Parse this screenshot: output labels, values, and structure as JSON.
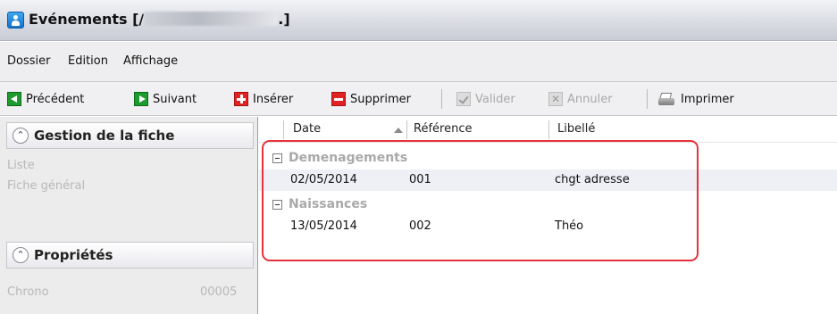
{
  "window": {
    "title": "Evénements [/",
    "title_suffix": ".]"
  },
  "menu": {
    "items": [
      "Dossier",
      "Edition",
      "Affichage"
    ]
  },
  "toolbar": {
    "prev": "Précédent",
    "next": "Suivant",
    "insert": "Insérer",
    "delete": "Supprimer",
    "validate": "Valider",
    "cancel": "Annuler",
    "print": "Imprimer",
    "icons": [
      "green-left-arrow",
      "green-right-arrow",
      "red-plus",
      "red-minus",
      "check-disabled",
      "x-disabled",
      "printer"
    ]
  },
  "left_panel": {
    "sections": [
      {
        "title": "Gestion de la fiche",
        "links": [
          "Liste",
          "Fiche général"
        ]
      },
      {
        "title": "Propriétés",
        "fields": [
          {
            "label": "Chrono",
            "value": "00005"
          }
        ]
      }
    ]
  },
  "grid": {
    "columns": [
      "Date",
      "Référence",
      "Libellé"
    ],
    "sorted_column": "Date",
    "groups": [
      {
        "name": "Demenagements",
        "rows": [
          {
            "date": "02/05/2014",
            "reference": "001",
            "libelle": "chgt adresse"
          }
        ]
      },
      {
        "name": "Naissances",
        "rows": [
          {
            "date": "13/05/2014",
            "reference": "002",
            "libelle": "Théo"
          }
        ]
      }
    ]
  },
  "colors": {
    "accent_highlight": "#e5323c",
    "selected_row": "#eef0f6",
    "group_text": "#a9a9a9"
  }
}
